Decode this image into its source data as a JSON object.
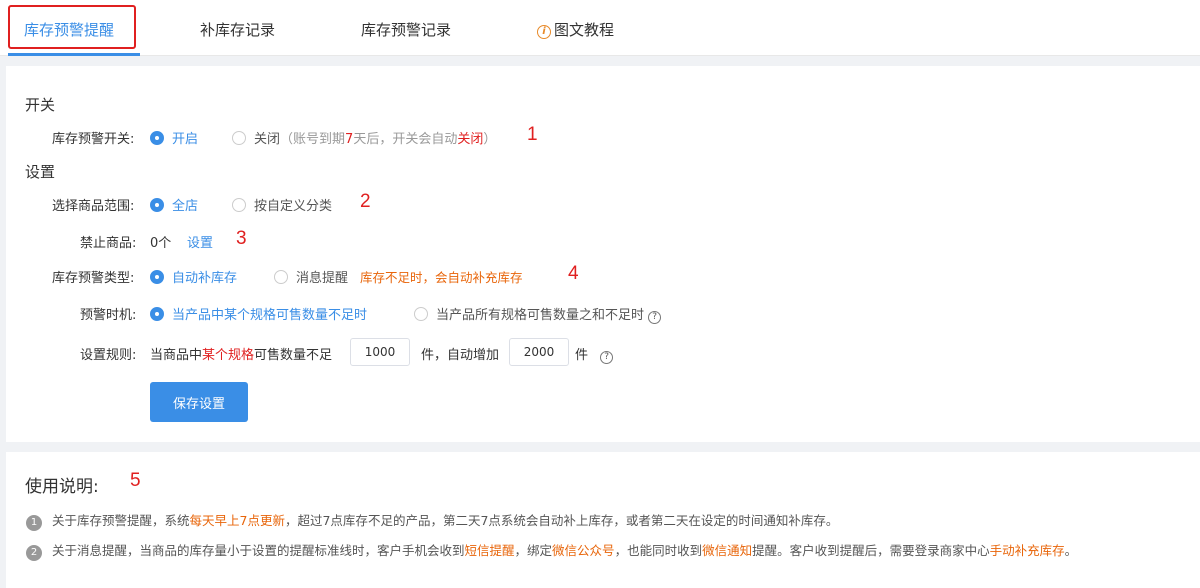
{
  "tabs": [
    {
      "label": "库存预警提醒"
    },
    {
      "label": "补库存记录"
    },
    {
      "label": "库存预警记录"
    },
    {
      "label": "图文教程",
      "icon": "info-icon"
    }
  ],
  "switch_section": {
    "title": "开关",
    "label": "库存预警开关:",
    "on_label": "开启",
    "off_label": "关闭",
    "off_note_prefix": "（账号到期",
    "off_note_days": "7",
    "off_note_mid": "天后，开关会自动",
    "off_note_closed": "关闭",
    "off_note_suffix": "）",
    "marker": "1"
  },
  "settings_section": {
    "title": "设置",
    "scope": {
      "label": "选择商品范围:",
      "opt1": "全店",
      "opt2": "按自定义分类",
      "marker": "2"
    },
    "banned": {
      "label": "禁止商品:",
      "count": "0个",
      "link": "设置",
      "marker": "3"
    },
    "type": {
      "label": "库存预警类型:",
      "opt1": "自动补库存",
      "opt2": "消息提醒",
      "hint": "库存不足时，会自动补充库存",
      "marker": "4"
    },
    "timing": {
      "label": "预警时机:",
      "opt1": "当产品中某个规格可售数量不足时",
      "opt2": "当产品所有规格可售数量之和不足时"
    },
    "rule": {
      "label": "设置规则:",
      "text1": "当商品中",
      "text_red": "某个规格",
      "text2": "可售数量不足",
      "threshold": "1000",
      "text3": "件，自动增加",
      "increase": "2000",
      "text4": "件"
    },
    "save_button": "保存设置"
  },
  "usage": {
    "title": "使用说明:",
    "marker": "5",
    "notes": [
      {
        "num": "1",
        "p1": "关于库存预警提醒，系统",
        "h1": "每天早上7点更新",
        "p2": "，超过7点库存不足的产品，第二天7点系统会自动补上库存，或者第二天在设定的时间通知补库存。"
      },
      {
        "num": "2",
        "p1": "关于消息提醒，当商品的库存量小于设置的提醒标准线时，客户手机会收到",
        "h1": "短信提醒",
        "p2": "，绑定",
        "h2": "微信公众号",
        "p3": "，也能同时收到",
        "h3": "微信通知",
        "p4": "提醒。客户收到提醒后，需要登录商家中心",
        "h4": "手动补充库存",
        "p5": "。"
      }
    ]
  },
  "colors": {
    "accent": "#3a8ee6",
    "red": "#e02020",
    "orange": "#e8650a"
  }
}
